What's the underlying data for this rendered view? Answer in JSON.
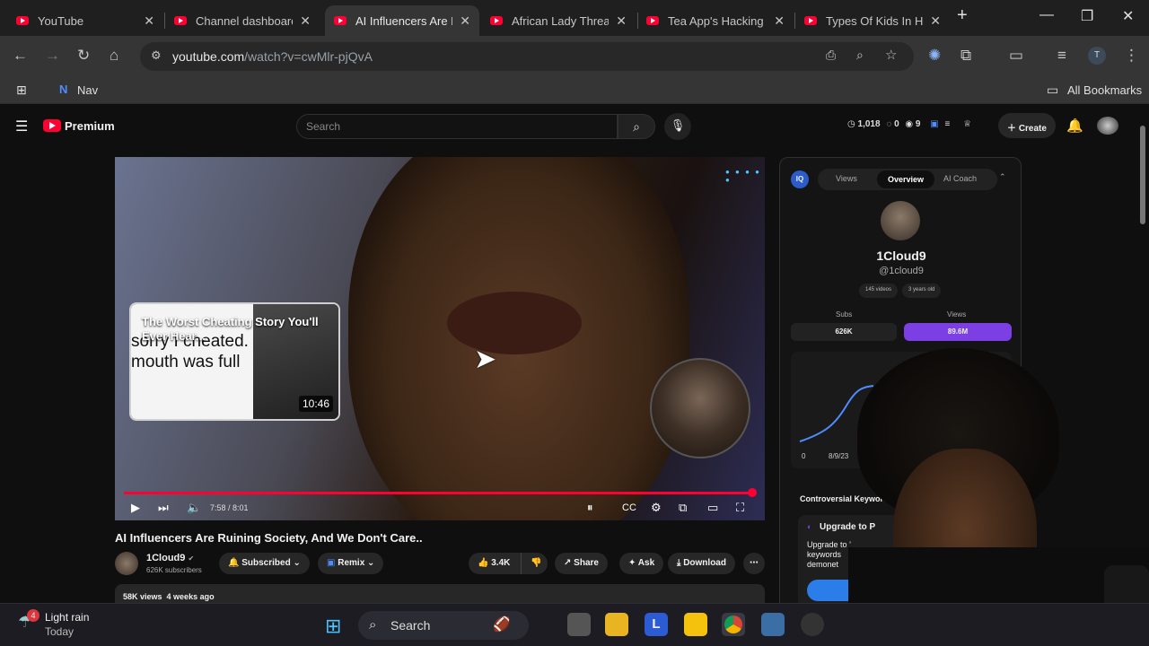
{
  "browser": {
    "tabs": [
      {
        "title": "YouTube"
      },
      {
        "title": "Channel dashboard"
      },
      {
        "title": "AI Influencers Are R"
      },
      {
        "title": "African Lady Threat"
      },
      {
        "title": "Tea App's Hacking"
      },
      {
        "title": "Types Of Kids In Hi"
      }
    ],
    "url_host": "youtube.com",
    "url_path": "/watch?v=cwMlr-pjQvA",
    "profile_initial": "T",
    "bookmarks": {
      "nav_label": "Nav",
      "all_bookmarks_label": "All Bookmarks"
    }
  },
  "youtube": {
    "logo_text": "Premium",
    "search_placeholder": "Search",
    "stats": {
      "views": "1,018",
      "comments": "0",
      "other": "9"
    },
    "create_label": "Create"
  },
  "player": {
    "endcard": {
      "title": "The Worst Cheating Story You'll Ever Hear...",
      "caption": "sorry I cheated. mouth was full",
      "duration": "10:46"
    },
    "timecode": "7:58 / 8:01",
    "progress_fraction": 0.994
  },
  "video": {
    "title": "AI Influencers Are Ruining Society, And We Don't Care..",
    "channel_name": "1Cloud9",
    "subscribers": "626K subscribers",
    "subscribed_label": "Subscribed",
    "remix_label": "Remix",
    "likes": "3.4K",
    "share_label": "Share",
    "ask_label": "Ask",
    "download_label": "Download",
    "views_meta": "58K views",
    "age_meta": "4 weeks ago"
  },
  "sidepanel": {
    "badge": "IQ",
    "tabs": [
      "Views",
      "Overview",
      "AI Coach"
    ],
    "active_tab": "Overview",
    "channel_name": "1Cloud9",
    "handle": "@1cloud9",
    "chips": [
      "145 videos",
      "3 years old"
    ],
    "subs_label": "Subs",
    "subs_value": "626K",
    "views_label": "Views",
    "views_value": "89.6M",
    "chart_x0": "0",
    "chart_date": "8/9/23",
    "keywords_title": "Controversial Keywords",
    "upgrade_title": "Upgrade to P",
    "upgrade_text": "Upgrade to ’ keywords demonet"
  },
  "taskbar": {
    "weather_badge": "4",
    "weather": "Light rain",
    "weather_sub": "Today",
    "search_label": "Search",
    "l_app_letter": "L"
  },
  "colors": {
    "accent_red": "#ff0033",
    "views_purple": "#7b3fe4",
    "iq_blue": "#2b5cc9"
  }
}
